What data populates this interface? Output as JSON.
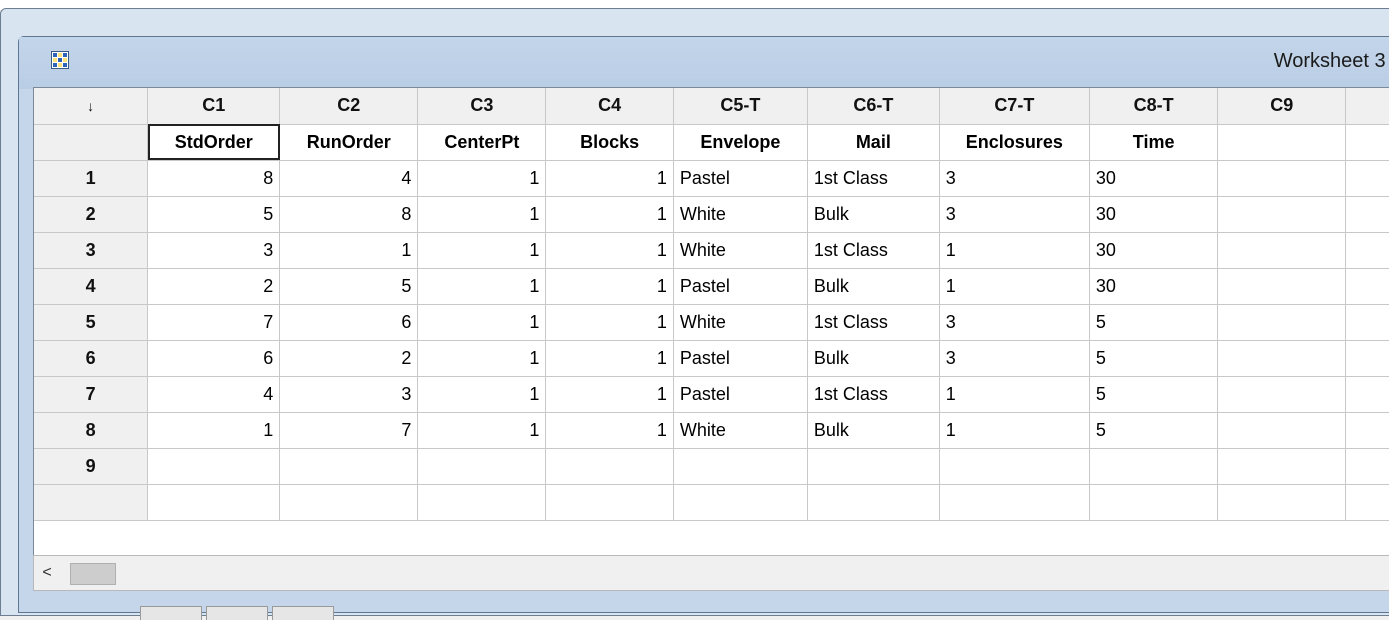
{
  "window": {
    "title": "Worksheet 3 *",
    "icon": "worksheet-icon"
  },
  "header": {
    "corner": "↓",
    "columns": [
      "C1",
      "C2",
      "C3",
      "C4",
      "C5-T",
      "C6-T",
      "C7-T",
      "C8-T",
      "C9",
      ""
    ],
    "names": [
      "StdOrder",
      "RunOrder",
      "CenterPt",
      "Blocks",
      "Envelope",
      "Mail",
      "Enclosures",
      "Time",
      "",
      ""
    ]
  },
  "rows": [
    {
      "index": "1",
      "cells": [
        "8",
        "4",
        "1",
        "1",
        "Pastel",
        "1st Class",
        "3",
        "30",
        "",
        ""
      ]
    },
    {
      "index": "2",
      "cells": [
        "5",
        "8",
        "1",
        "1",
        "White",
        "Bulk",
        "3",
        "30",
        "",
        ""
      ]
    },
    {
      "index": "3",
      "cells": [
        "3",
        "1",
        "1",
        "1",
        "White",
        "1st Class",
        "1",
        "30",
        "",
        ""
      ]
    },
    {
      "index": "4",
      "cells": [
        "2",
        "5",
        "1",
        "1",
        "Pastel",
        "Bulk",
        "1",
        "30",
        "",
        ""
      ]
    },
    {
      "index": "5",
      "cells": [
        "7",
        "6",
        "1",
        "1",
        "White",
        "1st Class",
        "3",
        "5",
        "",
        ""
      ]
    },
    {
      "index": "6",
      "cells": [
        "6",
        "2",
        "1",
        "1",
        "Pastel",
        "Bulk",
        "3",
        "5",
        "",
        ""
      ]
    },
    {
      "index": "7",
      "cells": [
        "4",
        "3",
        "1",
        "1",
        "Pastel",
        "1st Class",
        "1",
        "5",
        "",
        ""
      ]
    },
    {
      "index": "8",
      "cells": [
        "1",
        "7",
        "1",
        "1",
        "White",
        "Bulk",
        "1",
        "5",
        "",
        ""
      ]
    },
    {
      "index": "9",
      "cells": [
        "",
        "",
        "",
        "",
        "",
        "",
        "",
        "",
        "",
        ""
      ]
    },
    {
      "index": "",
      "cells": [
        "",
        "",
        "",
        "",
        "",
        "",
        "",
        "",
        "",
        ""
      ]
    }
  ],
  "scrollbar": {
    "left_arrow": "<"
  }
}
